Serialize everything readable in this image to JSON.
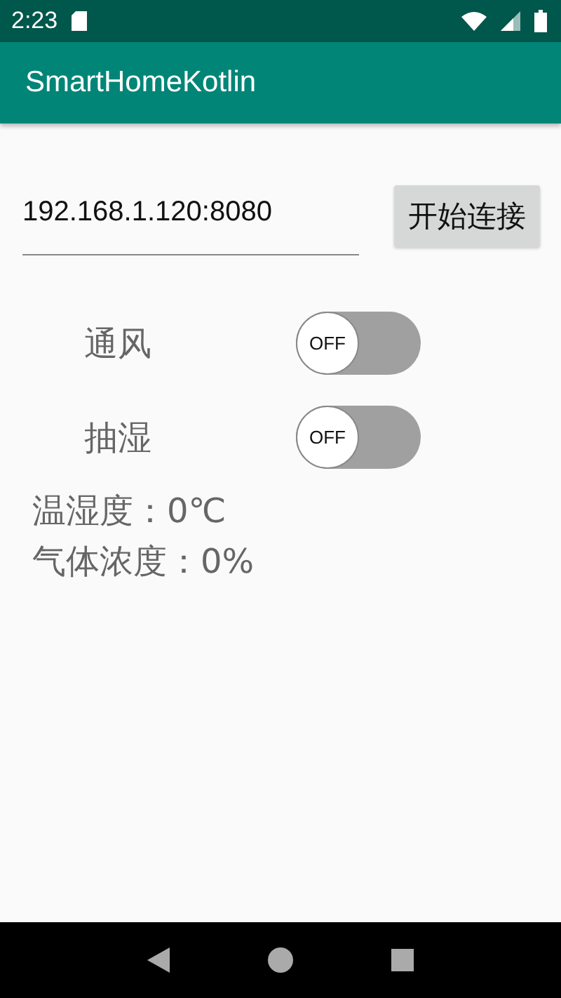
{
  "status_bar": {
    "time": "2:23"
  },
  "app_bar": {
    "title": "SmartHomeKotlin"
  },
  "address_field": {
    "value": "192.168.1.120:8080"
  },
  "connect_button": {
    "label": "开始连接"
  },
  "switches": [
    {
      "label": "通风",
      "on": false,
      "thumb_text": "OFF"
    },
    {
      "label": "抽湿",
      "on": false,
      "thumb_text": "OFF"
    }
  ],
  "readings": [
    "温湿度：0℃",
    "气体浓度：0%"
  ]
}
